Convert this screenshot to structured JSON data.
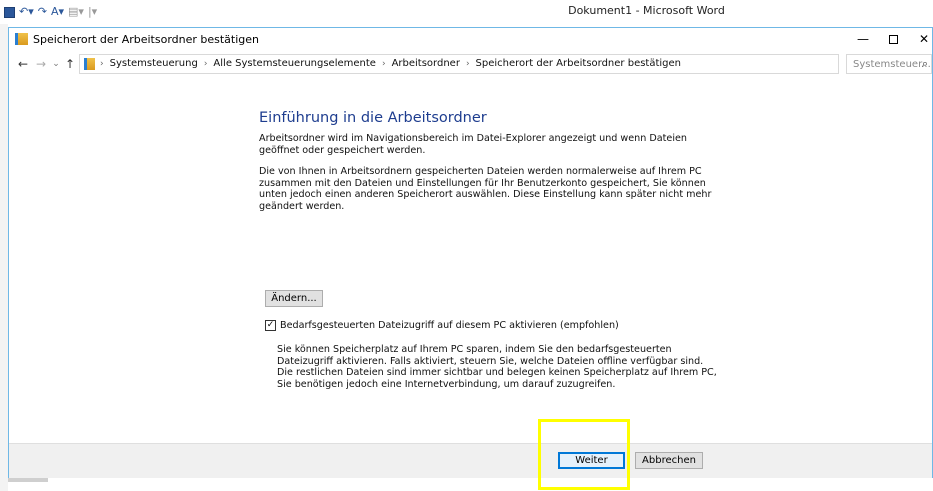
{
  "word": {
    "title": "Dokument1  -  Microsoft Word"
  },
  "window": {
    "title": "Speicherort der Arbeitsordner bestätigen",
    "min": "—",
    "close": "✕"
  },
  "nav": {
    "back": "←",
    "forward": "→",
    "recent": "⌄",
    "up": "↑"
  },
  "address": {
    "crumbs": [
      "Systemsteuerung",
      "Alle Systemsteuerungselemente",
      "Arbeitsordner",
      "Speicherort der Arbeitsordner bestätigen"
    ],
    "separator": "›",
    "dropdown": "⌄",
    "refresh": "↻"
  },
  "search": {
    "placeholder": "Systemsteuer...",
    "icon": "⌕"
  },
  "content": {
    "heading": "Einführung in die Arbeitsordner",
    "para1": "Arbeitsordner wird im Navigationsbereich im Datei-Explorer angezeigt und wenn Dateien geöffnet oder gespeichert werden.",
    "para2": "Die von Ihnen in Arbeitsordnern gespeicherten Dateien werden normalerweise auf Ihrem PC zusammen mit den Dateien und Einstellungen für Ihr Benutzerkonto gespeichert, Sie können unten jedoch einen anderen Speicherort auswählen. Diese Einstellung kann später nicht mehr geändert werden.",
    "change_button": "Ändern...",
    "checkbox_mark": "✓",
    "checkbox_label": "Bedarfsgesteuerten Dateizugriff auf diesem PC aktivieren (empfohlen)",
    "para3": "Sie können Speicherplatz auf Ihrem PC sparen, indem Sie den bedarfsgesteuerten Dateizugriff aktivieren. Falls aktiviert, steuern Sie, welche Dateien offline verfügbar sind. Die restlichen Dateien sind immer sichtbar und belegen keinen Speicherplatz auf Ihrem PC, Sie benötigen jedoch eine Internetverbindung, um darauf zuzugreifen."
  },
  "footer": {
    "next": "Weiter",
    "cancel": "Abbrechen"
  },
  "colors": {
    "heading": "#1e3d8f",
    "window_border": "#6fb8e6",
    "highlight": "#ffff00",
    "default_button_border": "#0078d7"
  }
}
